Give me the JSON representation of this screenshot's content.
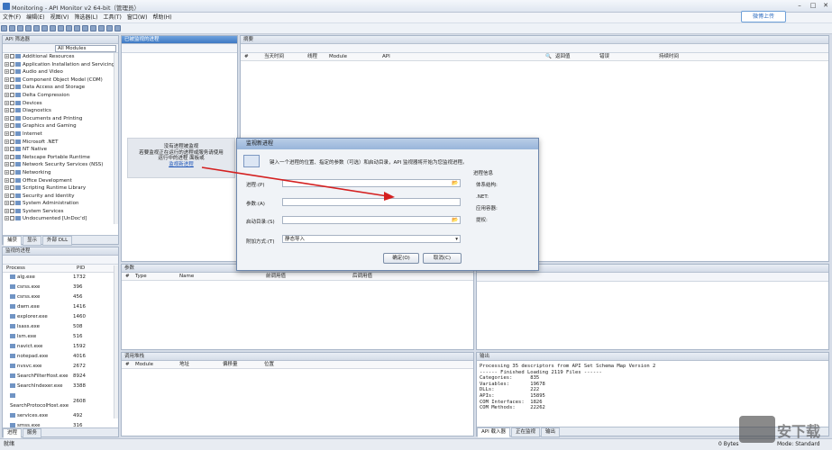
{
  "window": {
    "title": "Monitoring - API Monitor v2 64-bit（管理员）"
  },
  "menu": [
    "文件(F)",
    "编辑(E)",
    "视图(V)",
    "筛选器(L)",
    "工具(T)",
    "窗口(W)",
    "帮助(H)"
  ],
  "share_button": "微博上传",
  "api_filter": {
    "title": "API 筛选器",
    "dropdown": "All Modules",
    "items": [
      "Additional Resources",
      "Application Installation and Servicing",
      "Audio and Video",
      "Component Object Model (COM)",
      "Data Access and Storage",
      "Delta Compression",
      "Devices",
      "Diagnostics",
      "Documents and Printing",
      "Graphics and Gaming",
      "Internet",
      "Microsoft .NET",
      "NT Native",
      "Netscape Portable Runtime",
      "Network Security Services (NSS)",
      "Networking",
      "Office Development",
      "Scripting Runtime Library",
      "Security and Identity",
      "System Administration",
      "System Services",
      "Undocumented [UnDoc'd]"
    ],
    "tabs": [
      "捕获",
      "显示",
      "外部 DLL"
    ]
  },
  "processes": {
    "title": "监视的进程",
    "tabs": [
      "进程",
      "服务"
    ],
    "columns": [
      "Process",
      "PID"
    ],
    "rows": [
      [
        "alg.exe",
        "1732"
      ],
      [
        "csrss.exe",
        "396"
      ],
      [
        "csrss.exe",
        "456"
      ],
      [
        "dwm.exe",
        "1416"
      ],
      [
        "explorer.exe",
        "1460"
      ],
      [
        "lsass.exe",
        "508"
      ],
      [
        "lsm.exe",
        "516"
      ],
      [
        "navict.exe",
        "1592"
      ],
      [
        "notepad.exe",
        "4016"
      ],
      [
        "nvsvc.exe",
        "2672"
      ],
      [
        "SearchFilterHost.exe",
        "8924"
      ],
      [
        "SearchIndexer.exe",
        "3388"
      ],
      [
        "SearchProtocolHost.exe",
        "2608"
      ],
      [
        "services.exe",
        "492"
      ],
      [
        "smss.exe",
        "316"
      ]
    ]
  },
  "monitored": {
    "title": "已被监视的进程",
    "empty_lines": [
      "没有进程被监视",
      "若要监视正在运行的进程或服务请使用",
      "运行中的进程 面板或"
    ],
    "link": "监视新进程"
  },
  "summary": {
    "title": "摘要",
    "columns": [
      "#",
      "当天时间",
      "线程",
      "Module",
      "API",
      "返回值",
      "错误",
      "持续时间"
    ]
  },
  "params": {
    "title": "参数",
    "columns": [
      "#",
      "Type",
      "Name",
      "前调用值",
      "后调用值"
    ]
  },
  "callstack": {
    "title": "调用堆栈",
    "columns": [
      "#",
      "Module",
      "地址",
      "偏移量",
      "位置"
    ]
  },
  "output": {
    "title": "输出",
    "lines": [
      "Processing 35 descriptors from API Set Schema Map Version 2",
      "------ Finished Loading 2119 Files ------",
      "Categories:      835",
      "Variables:       19678",
      "DLLs:            222",
      "APIs:            15895",
      "COM Interfaces:  1826",
      "COM Methods:     22262"
    ],
    "tabs": [
      "API 载入器",
      "正在监视",
      "输出"
    ]
  },
  "dialog": {
    "title": "监视新进程",
    "desc": "键入一个进程的位置、指定的参数（可选）和启动目录，API 监视器将开始为您监视进程。",
    "labels": {
      "process": "进程:(P)",
      "args": "参数:(A)",
      "startdir": "启动目录:(S)",
      "attach": "附加方式:(T)"
    },
    "attach_value": "静态导入",
    "ok": "确定(O)",
    "cancel": "取消(C)",
    "info": {
      "title": "进程信息",
      "arch": "体系结构:",
      "net": ".NET:",
      "container": "应用容器:",
      "elevated": "提权:"
    }
  },
  "status": {
    "left": "就绪",
    "bytes": "0 Bytes",
    "mode": "Mode: Standard"
  },
  "watermark": "安下载"
}
